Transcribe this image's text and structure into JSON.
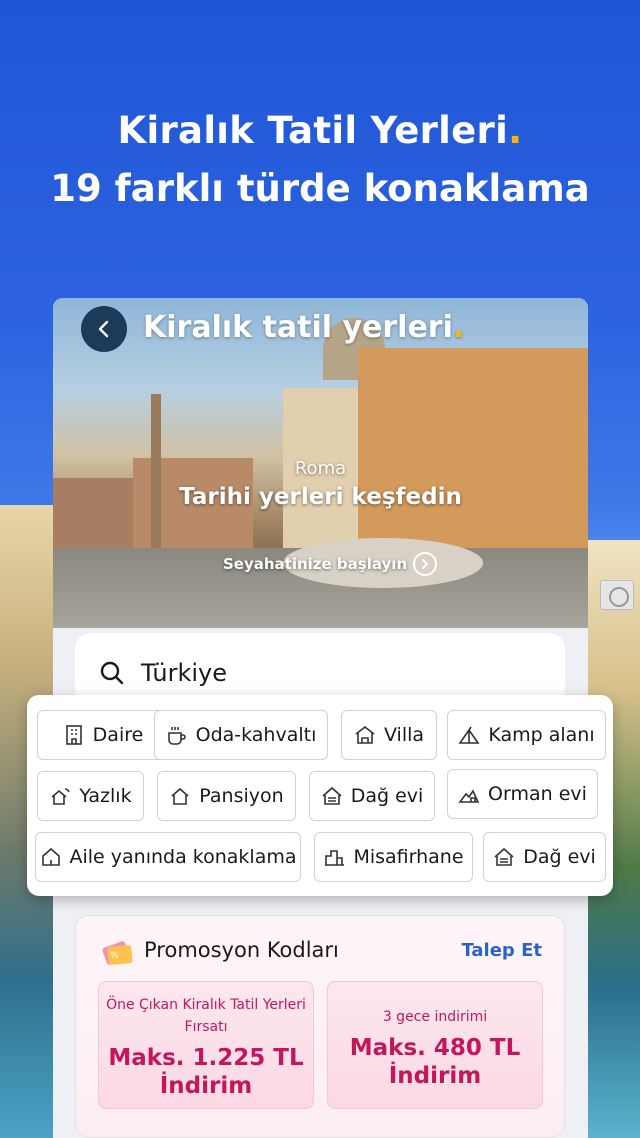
{
  "hero": {
    "line1": "Kiralık Tatil Yerleri",
    "line2": "19 farklı türde konaklama",
    "accent_dot": "."
  },
  "banner": {
    "title": "Kiralık tatil yerleri",
    "city": "Roma",
    "subtitle": "Tarihi yerleri keşfedin",
    "cta": "Seyahatinize başlayın"
  },
  "search": {
    "value": "Türkiye"
  },
  "chips": [
    {
      "label": "Daire",
      "icon": "building-icon"
    },
    {
      "label": "Oda-kahvaltı",
      "icon": "coffee-icon"
    },
    {
      "label": "Villa",
      "icon": "villa-icon"
    },
    {
      "label": "Kamp alanı",
      "icon": "tent-icon"
    },
    {
      "label": "Yazlık",
      "icon": "beach-house-icon"
    },
    {
      "label": "Pansiyon",
      "icon": "house-icon"
    },
    {
      "label": "Dağ evi",
      "icon": "chalet-icon"
    },
    {
      "label": "Orman evi",
      "icon": "forest-house-icon"
    },
    {
      "label": "Aile yanında konaklama",
      "icon": "home-icon"
    },
    {
      "label": "Misafirhane",
      "icon": "guesthouse-icon"
    },
    {
      "label": "Dağ evi",
      "icon": "chalet-icon"
    }
  ],
  "promo": {
    "title": "Promosyon Kodları",
    "link": "Talep Et",
    "coupons": [
      {
        "small1": "Öne Çıkan Kiralık Tatil Yerleri",
        "small2": "Fırsatı",
        "big1": "Maks. 1.225 TL",
        "big2": "İndirim"
      },
      {
        "small1": "3 gece indirimi",
        "big1": "Maks. 480 TL",
        "big2": "İndirim"
      }
    ]
  },
  "colors": {
    "accent_dot": "#ffb400",
    "promo_text": "#c2185b",
    "link": "#2864c8"
  }
}
